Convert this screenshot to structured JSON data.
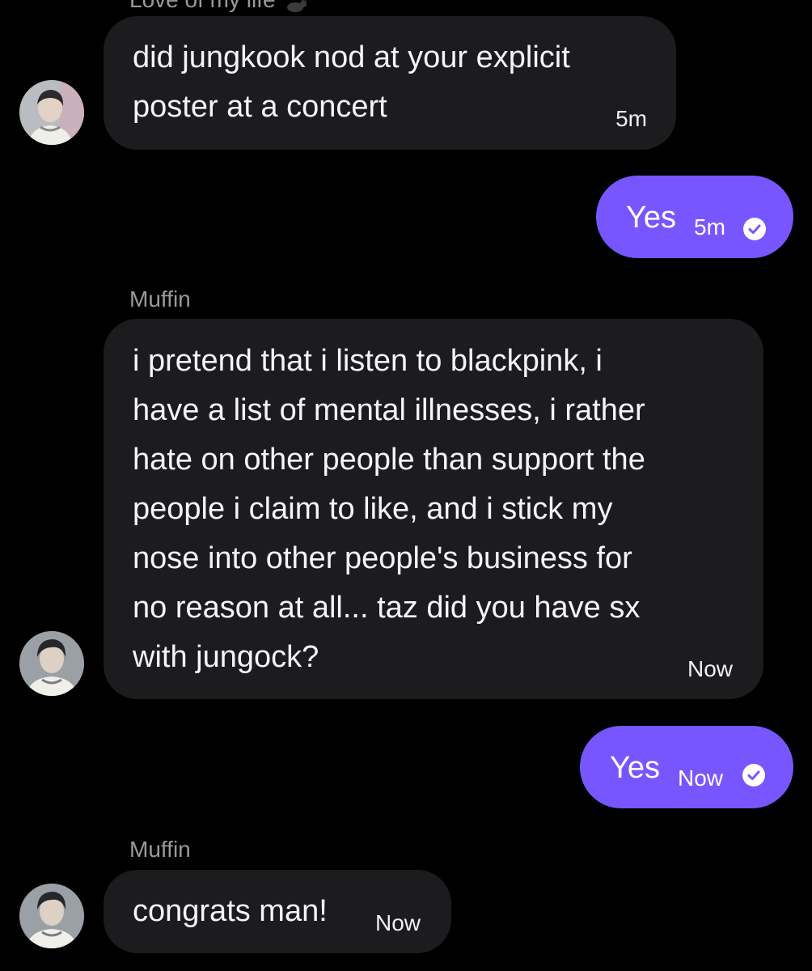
{
  "messages": [
    {
      "sender": "Love of my life",
      "text": "did jungkook nod at your explicit\nposter at a concert",
      "time": "5m"
    },
    {
      "reply": "Yes",
      "time": "5m"
    },
    {
      "sender": "Muffin",
      "text": "i pretend that i listen to blackpink, i\nhave a list of mental illnesses, i rather\nhate on other people than support the\npeople i claim to like, and i stick my\nnose into other people's business for\nno reason at all... taz did you have sx\nwith jungock?",
      "time": "Now"
    },
    {
      "reply": "Yes",
      "time": "Now"
    },
    {
      "sender": "Muffin",
      "text": "congrats man!",
      "time": "Now"
    }
  ],
  "icons": {
    "sender_emoji": "cat-emoji",
    "read_receipt": "check-circle-icon"
  },
  "colors": {
    "background": "#000000",
    "incoming_bubble": "#1c1c1f",
    "outgoing_bubble": "#7856ff",
    "sender_name": "#9a9a9e"
  }
}
